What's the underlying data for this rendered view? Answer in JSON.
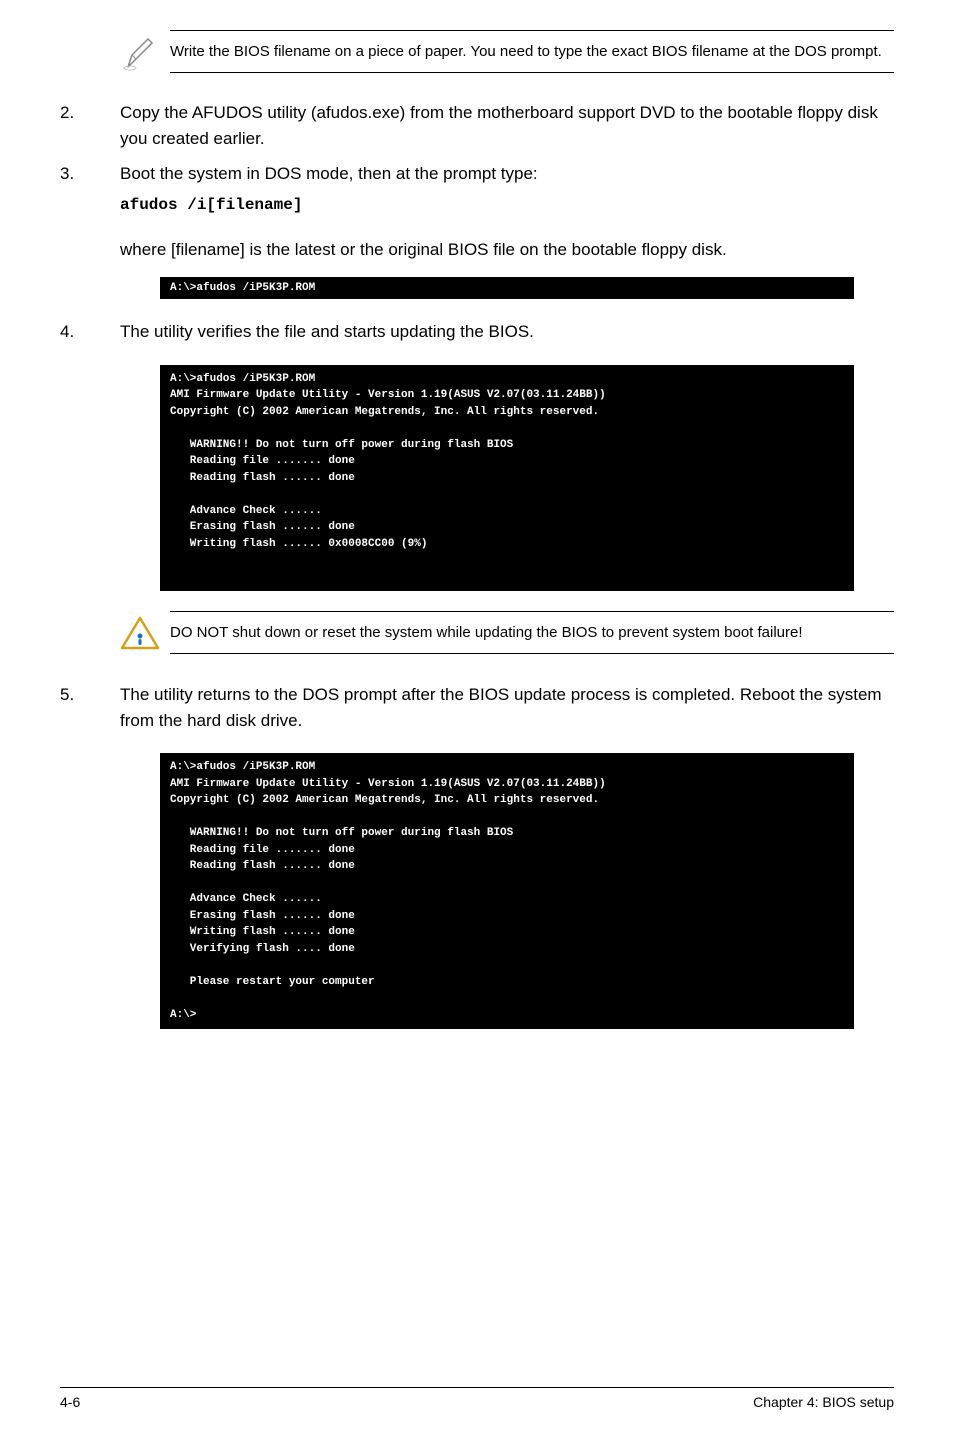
{
  "note1": {
    "text": "Write the BIOS filename on a piece of paper. You need to type the exact BIOS filename at the DOS prompt."
  },
  "step2": {
    "num": "2.",
    "text": "Copy the AFUDOS utility (afudos.exe) from the motherboard support DVD to the bootable floppy disk you created earlier."
  },
  "step3": {
    "num": "3.",
    "text": "Boot the system in DOS mode, then at the prompt type:",
    "code": "afudos /i[filename]"
  },
  "sub3": "where [filename] is the latest or the original BIOS file on the bootable floppy disk.",
  "term1": "A:\\>afudos /iP5K3P.ROM",
  "step4": {
    "num": "4.",
    "text": "The utility verifies the file and starts updating the BIOS."
  },
  "term2": "A:\\>afudos /iP5K3P.ROM\nAMI Firmware Update Utility - Version 1.19(ASUS V2.07(03.11.24BB))\nCopyright (C) 2002 American Megatrends, Inc. All rights reserved.\n\n   WARNING!! Do not turn off power during flash BIOS\n   Reading file ....... done\n   Reading flash ...... done\n\n   Advance Check ......\n   Erasing flash ...... done\n   Writing flash ...... 0x0008CC00 (9%)\n\n\n",
  "warn1": {
    "text": "DO NOT shut down or reset the system while updating the BIOS to prevent system boot failure!"
  },
  "step5": {
    "num": "5.",
    "text": "The utility returns to the DOS prompt after the BIOS update process is completed. Reboot the system from the hard disk drive."
  },
  "term3": "A:\\>afudos /iP5K3P.ROM\nAMI Firmware Update Utility - Version 1.19(ASUS V2.07(03.11.24BB))\nCopyright (C) 2002 American Megatrends, Inc. All rights reserved.\n\n   WARNING!! Do not turn off power during flash BIOS\n   Reading file ....... done\n   Reading flash ...... done\n\n   Advance Check ......\n   Erasing flash ...... done\n   Writing flash ...... done\n   Verifying flash .... done\n\n   Please restart your computer\n\nA:\\>",
  "footer": {
    "left": "4-6",
    "right": "Chapter 4: BIOS setup"
  }
}
